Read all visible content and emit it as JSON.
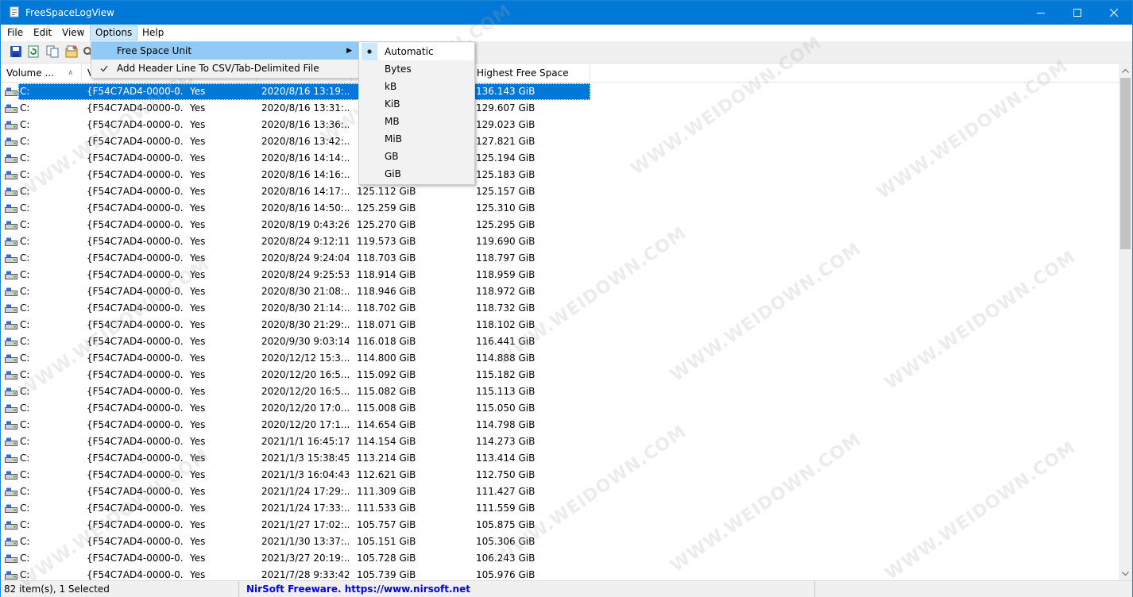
{
  "window": {
    "title": "FreeSpaceLogView"
  },
  "menubar": {
    "items": [
      {
        "label": "File"
      },
      {
        "label": "Edit"
      },
      {
        "label": "View"
      },
      {
        "label": "Options"
      },
      {
        "label": "Help"
      }
    ]
  },
  "options_menu": {
    "items": [
      {
        "label": "Free Space Unit",
        "has_submenu": true,
        "checked": false
      },
      {
        "label": "Add Header Line To CSV/Tab-Delimited File",
        "has_submenu": false,
        "checked": true
      }
    ]
  },
  "unit_submenu": {
    "items": [
      {
        "label": "Automatic",
        "selected": true
      },
      {
        "label": "Bytes",
        "selected": false
      },
      {
        "label": "kB",
        "selected": false
      },
      {
        "label": "KiB",
        "selected": false
      },
      {
        "label": "MB",
        "selected": false
      },
      {
        "label": "MiB",
        "selected": false
      },
      {
        "label": "GB",
        "selected": false
      },
      {
        "label": "GiB",
        "selected": false
      }
    ]
  },
  "toolbar": {
    "icons": [
      "save-icon",
      "refresh-icon",
      "copy-icon",
      "properties-icon",
      "find-icon"
    ]
  },
  "table": {
    "columns": [
      {
        "label": "Volume ...",
        "sorted": true
      },
      {
        "label": "V",
        "sorted": false
      },
      {
        "label": "",
        "sorted": false
      },
      {
        "label": "",
        "sorted": false
      },
      {
        "label": "",
        "sorted": false
      },
      {
        "label": "Highest Free Space",
        "sorted": false
      }
    ],
    "rows": [
      {
        "vol": "C:",
        "guid": "{F54C7AD4-0000-0...",
        "flag": "Yes",
        "time": "2020/8/16 13:19:...",
        "free": "",
        "high": "136.143 GiB",
        "selected": true
      },
      {
        "vol": "C:",
        "guid": "{F54C7AD4-0000-0...",
        "flag": "Yes",
        "time": "2020/8/16 13:31:...",
        "free": "",
        "high": "129.607 GiB"
      },
      {
        "vol": "C:",
        "guid": "{F54C7AD4-0000-0...",
        "flag": "Yes",
        "time": "2020/8/16 13:36:...",
        "free": "",
        "high": "129.023 GiB"
      },
      {
        "vol": "C:",
        "guid": "{F54C7AD4-0000-0...",
        "flag": "Yes",
        "time": "2020/8/16 13:42:...",
        "free": "",
        "high": "127.821 GiB"
      },
      {
        "vol": "C:",
        "guid": "{F54C7AD4-0000-0...",
        "flag": "Yes",
        "time": "2020/8/16 14:14:...",
        "free": "",
        "high": "125.194 GiB"
      },
      {
        "vol": "C:",
        "guid": "{F54C7AD4-0000-0...",
        "flag": "Yes",
        "time": "2020/8/16 14:16:...",
        "free": "",
        "high": "125.183 GiB"
      },
      {
        "vol": "C:",
        "guid": "{F54C7AD4-0000-0...",
        "flag": "Yes",
        "time": "2020/8/16 14:17:...",
        "free": "125.112 GiB",
        "high": "125.157 GiB"
      },
      {
        "vol": "C:",
        "guid": "{F54C7AD4-0000-0...",
        "flag": "Yes",
        "time": "2020/8/16 14:50:...",
        "free": "125.259 GiB",
        "high": "125.310 GiB"
      },
      {
        "vol": "C:",
        "guid": "{F54C7AD4-0000-0...",
        "flag": "Yes",
        "time": "2020/8/19 0:43:26",
        "free": "125.270 GiB",
        "high": "125.295 GiB"
      },
      {
        "vol": "C:",
        "guid": "{F54C7AD4-0000-0...",
        "flag": "Yes",
        "time": "2020/8/24 9:12:11",
        "free": "119.573 GiB",
        "high": "119.690 GiB"
      },
      {
        "vol": "C:",
        "guid": "{F54C7AD4-0000-0...",
        "flag": "Yes",
        "time": "2020/8/24 9:24:04",
        "free": "118.703 GiB",
        "high": "118.797 GiB"
      },
      {
        "vol": "C:",
        "guid": "{F54C7AD4-0000-0...",
        "flag": "Yes",
        "time": "2020/8/24 9:25:53",
        "free": "118.914 GiB",
        "high": "118.959 GiB"
      },
      {
        "vol": "C:",
        "guid": "{F54C7AD4-0000-0...",
        "flag": "Yes",
        "time": "2020/8/30 21:08:...",
        "free": "118.946 GiB",
        "high": "118.972 GiB"
      },
      {
        "vol": "C:",
        "guid": "{F54C7AD4-0000-0...",
        "flag": "Yes",
        "time": "2020/8/30 21:14:...",
        "free": "118.702 GiB",
        "high": "118.732 GiB"
      },
      {
        "vol": "C:",
        "guid": "{F54C7AD4-0000-0...",
        "flag": "Yes",
        "time": "2020/8/30 21:29:...",
        "free": "118.071 GiB",
        "high": "118.102 GiB"
      },
      {
        "vol": "C:",
        "guid": "{F54C7AD4-0000-0...",
        "flag": "Yes",
        "time": "2020/9/30 9:03:14",
        "free": "116.018 GiB",
        "high": "116.441 GiB"
      },
      {
        "vol": "C:",
        "guid": "{F54C7AD4-0000-0...",
        "flag": "Yes",
        "time": "2020/12/12 15:3...",
        "free": "114.800 GiB",
        "high": "114.888 GiB"
      },
      {
        "vol": "C:",
        "guid": "{F54C7AD4-0000-0...",
        "flag": "Yes",
        "time": "2020/12/20 16:5...",
        "free": "115.092 GiB",
        "high": "115.182 GiB"
      },
      {
        "vol": "C:",
        "guid": "{F54C7AD4-0000-0...",
        "flag": "Yes",
        "time": "2020/12/20 16:5...",
        "free": "115.082 GiB",
        "high": "115.113 GiB"
      },
      {
        "vol": "C:",
        "guid": "{F54C7AD4-0000-0...",
        "flag": "Yes",
        "time": "2020/12/20 17:0...",
        "free": "115.008 GiB",
        "high": "115.050 GiB"
      },
      {
        "vol": "C:",
        "guid": "{F54C7AD4-0000-0...",
        "flag": "Yes",
        "time": "2020/12/20 17:1...",
        "free": "114.654 GiB",
        "high": "114.798 GiB"
      },
      {
        "vol": "C:",
        "guid": "{F54C7AD4-0000-0...",
        "flag": "Yes",
        "time": "2021/1/1 16:45:17",
        "free": "114.154 GiB",
        "high": "114.273 GiB"
      },
      {
        "vol": "C:",
        "guid": "{F54C7AD4-0000-0...",
        "flag": "Yes",
        "time": "2021/1/3 15:38:45",
        "free": "113.214 GiB",
        "high": "113.414 GiB"
      },
      {
        "vol": "C:",
        "guid": "{F54C7AD4-0000-0...",
        "flag": "Yes",
        "time": "2021/1/3 16:04:43",
        "free": "112.621 GiB",
        "high": "112.750 GiB"
      },
      {
        "vol": "C:",
        "guid": "{F54C7AD4-0000-0...",
        "flag": "Yes",
        "time": "2021/1/24 17:29:...",
        "free": "111.309 GiB",
        "high": "111.427 GiB"
      },
      {
        "vol": "C:",
        "guid": "{F54C7AD4-0000-0...",
        "flag": "Yes",
        "time": "2021/1/24 17:33:...",
        "free": "111.533 GiB",
        "high": "111.559 GiB"
      },
      {
        "vol": "C:",
        "guid": "{F54C7AD4-0000-0...",
        "flag": "Yes",
        "time": "2021/1/27 17:02:...",
        "free": "105.757 GiB",
        "high": "105.875 GiB"
      },
      {
        "vol": "C:",
        "guid": "{F54C7AD4-0000-0...",
        "flag": "Yes",
        "time": "2021/1/30 13:37:...",
        "free": "105.151 GiB",
        "high": "105.306 GiB"
      },
      {
        "vol": "C:",
        "guid": "{F54C7AD4-0000-0...",
        "flag": "Yes",
        "time": "2021/3/27 20:19:...",
        "free": "105.728 GiB",
        "high": "106.243 GiB"
      },
      {
        "vol": "C:",
        "guid": "{F54C7AD4-0000-0...",
        "flag": "Yes",
        "time": "2021/7/28 9:33:42",
        "free": "105.739 GiB",
        "high": "105.976 GiB"
      }
    ]
  },
  "statusbar": {
    "count": "82 item(s), 1 Selected",
    "link": "NirSoft Freeware. https://www.nirsoft.net"
  },
  "colors": {
    "titlebar": "#0078d7",
    "selection": "#0078d7",
    "menu_hover": "#91c9f7",
    "link": "#0000ff"
  }
}
